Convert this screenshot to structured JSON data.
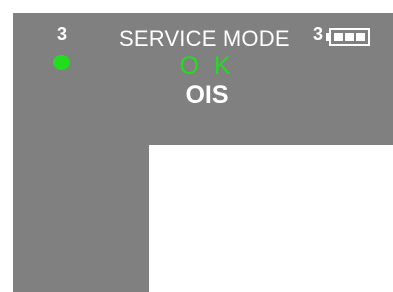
{
  "device": {
    "left_channel": "3",
    "right_channel": "3",
    "mode_title": "SERVICE MODE",
    "status_primary": "O K",
    "status_secondary": "OIS",
    "battery_level": 1.0
  },
  "colors": {
    "panel": "#808080",
    "text": "#ffffff",
    "ok_green": "#22dd1e",
    "led_green": "#22dd1e",
    "background": "#ffffff"
  },
  "icons": {
    "led": "status-led-icon",
    "battery": "battery-icon"
  }
}
